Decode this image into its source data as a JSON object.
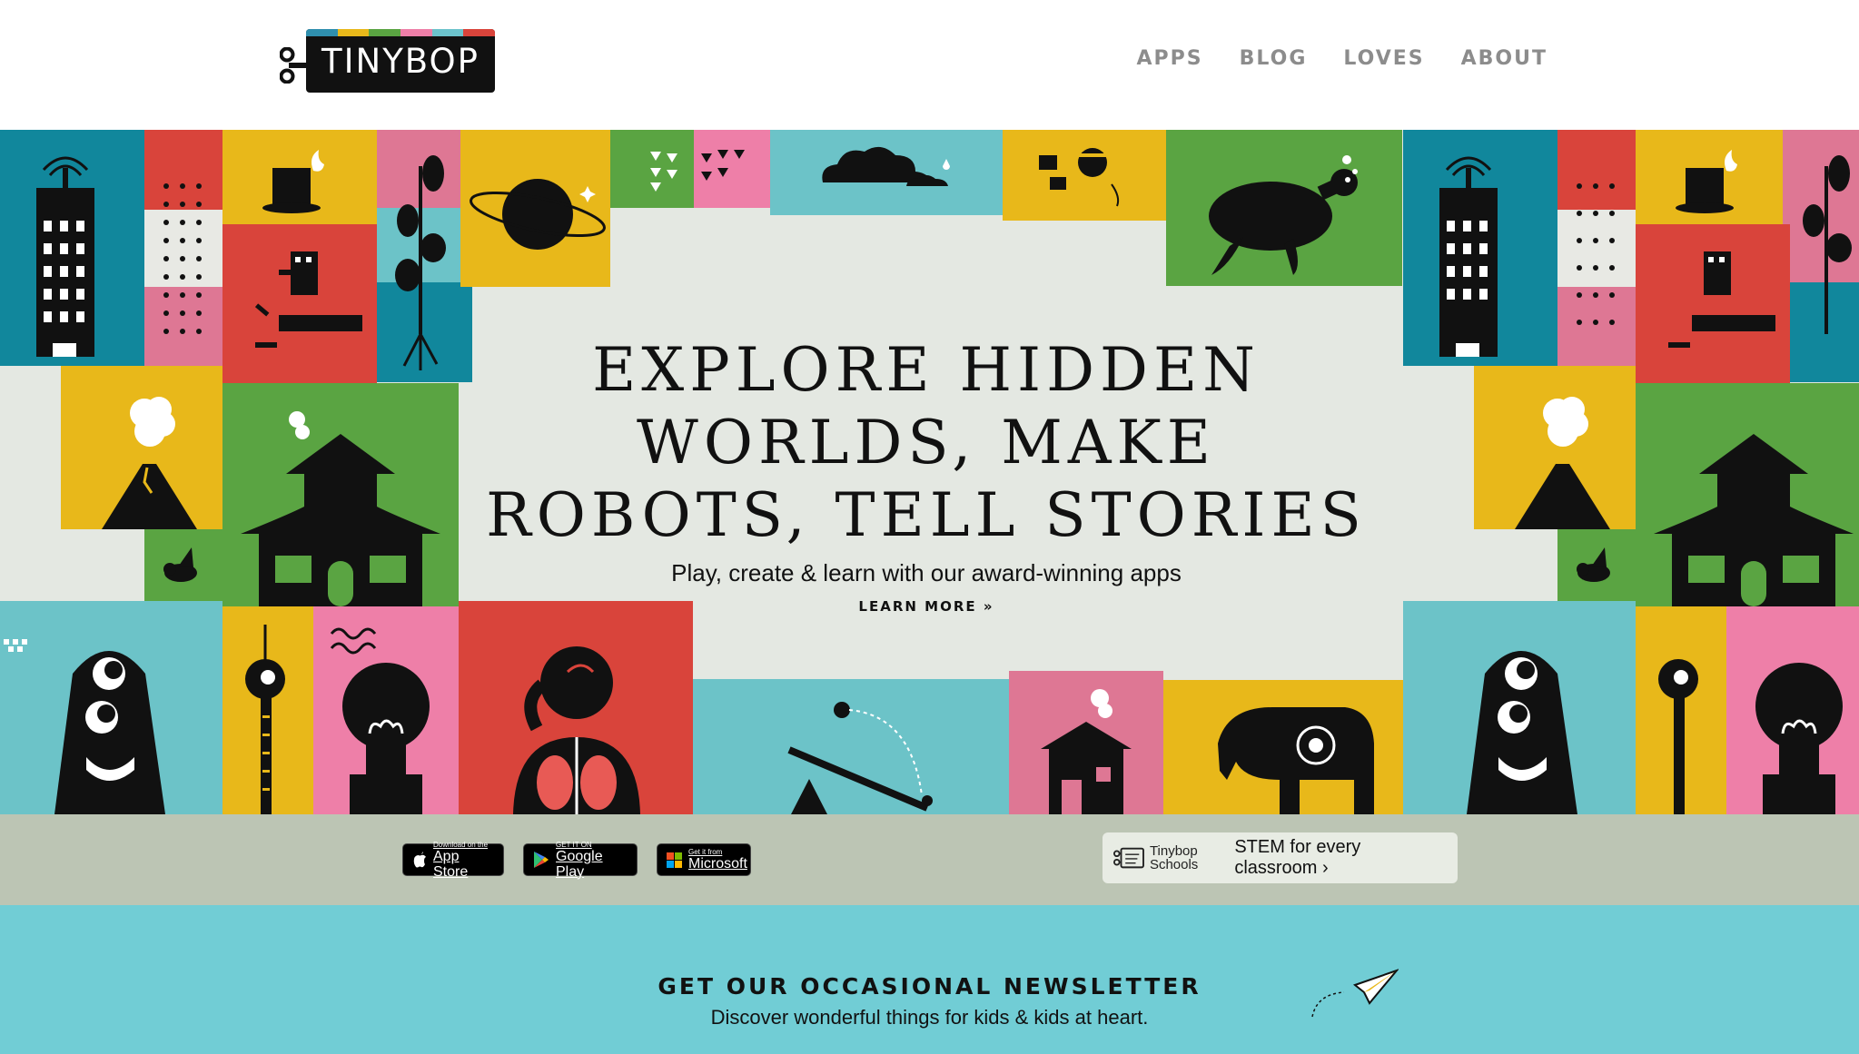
{
  "brand": {
    "logo_text": "TINYBOP",
    "stripe_colors": [
      "#2f8fae",
      "#e8b81a",
      "#5aa442",
      "#ee7fa8",
      "#6cc3cc",
      "#d9443b"
    ]
  },
  "nav": {
    "items": [
      "APPS",
      "BLOG",
      "LOVES",
      "ABOUT"
    ]
  },
  "hero": {
    "title_line1": "EXPLORE HIDDEN",
    "title_line2": "WORLDS, MAKE",
    "title_line3": "ROBOTS, TELL STORIES",
    "subtitle": "Play, create & learn with our award-winning apps",
    "link": "LEARN MORE »"
  },
  "stores": {
    "app_store": {
      "small": "Download on the",
      "big": "App Store"
    },
    "google_play": {
      "small": "GET IT ON",
      "big": "Google Play"
    },
    "microsoft": {
      "small": "Get it from",
      "big": "Microsoft"
    },
    "schools_logo_line1": "Tinybop",
    "schools_logo_line2": "Schools",
    "schools_tagline": "STEM for every classroom ›"
  },
  "newsletter": {
    "title": "GET OUR OCCASIONAL NEWSLETTER",
    "subtitle": "Discover wonderful things for kids & kids at heart."
  },
  "colors": {
    "teal": "#11879c",
    "red": "#d9443b",
    "yellow": "#e8b81a",
    "green": "#5aa442",
    "pink": "#ee7fa8",
    "light_teal": "#6cc3c8",
    "dusty_pink": "#de7794",
    "newsletter_bg": "#71cdd5",
    "stores_bg": "#bcc5b4",
    "hero_bg": "#e4e8e2",
    "nav_text": "#8c8c8c"
  },
  "icons": [
    "wind-up-key-icon",
    "apple-icon",
    "play-store-icon",
    "windows-icon",
    "schools-logo-icon",
    "paper-plane-icon"
  ]
}
